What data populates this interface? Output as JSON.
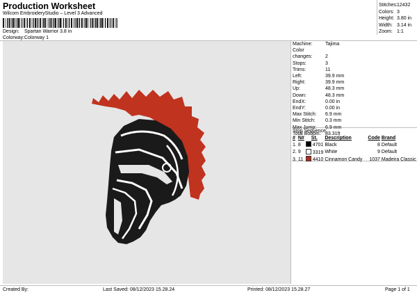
{
  "header": {
    "title": "Production Worksheet",
    "subtitle": "Wilcom EmbroideryStudio – Level 3 Advanced"
  },
  "meta": {
    "design_label": "Design:",
    "design_value": "Spartan Warrior 3.8 in",
    "colorway_label": "Colorway:",
    "colorway_value": "Colorway 1"
  },
  "stats": [
    {
      "label": "Stitches:",
      "value": "12432"
    },
    {
      "label": "Colors:",
      "value": "3"
    },
    {
      "label": "Height:",
      "value": "3.80 in"
    },
    {
      "label": "Width:",
      "value": "3.14 in"
    },
    {
      "label": "Zoom:",
      "value": "1:1"
    }
  ],
  "machine_info": [
    {
      "label": "Machine:",
      "value": "Tajima"
    },
    {
      "label": "Color changes:",
      "value": "2"
    },
    {
      "label": "Stops:",
      "value": "3"
    },
    {
      "label": "Trims:",
      "value": "11"
    },
    {
      "label": "Left:",
      "value": "39.9 mm"
    },
    {
      "label": "Right:",
      "value": "39.9 mm"
    },
    {
      "label": "Up:",
      "value": "48.3 mm"
    },
    {
      "label": "Down:",
      "value": "48.3 mm"
    },
    {
      "label": "EndX:",
      "value": "0.00 in"
    },
    {
      "label": "EndY:",
      "value": "0.00 in"
    },
    {
      "label": "Max Stitch:",
      "value": "6.9 mm"
    },
    {
      "label": "Min Stitch:",
      "value": "0.3 mm"
    },
    {
      "label": "Max Jump:",
      "value": "6.9 mm"
    },
    {
      "label": "Total Bobbin:",
      "value": "83.31ft"
    }
  ],
  "stop_sequence": {
    "title": "Stop Sequence:",
    "columns": [
      "#",
      "N#",
      "St.",
      "Description",
      "Code",
      "Brand"
    ],
    "rows": [
      {
        "num": "1.",
        "n": "8",
        "color": "#000000",
        "st": "4701",
        "desc": "Black",
        "code": "8",
        "brand": "Default"
      },
      {
        "num": "2.",
        "n": "9",
        "color": "#ffffff",
        "st": "3319",
        "desc": "White",
        "code": "9",
        "brand": "Default"
      },
      {
        "num": "3.",
        "n": "11",
        "color": "#b22a1a",
        "st": "4410",
        "desc": "Cinnamon Candy",
        "code": "1037",
        "brand": "Madeira Classic 40"
      }
    ]
  },
  "footer": {
    "created_by": "Created By:",
    "last_saved": "Last Saved: 08/12/2023 15.28.24",
    "printed": "Printed: 08/12/2023 15.28.27",
    "page": "Page 1 of 1"
  },
  "colors": {
    "background": "#e6e6e6",
    "plume": "#c0331f",
    "helmet": "#1a1a1a",
    "highlight": "#ffffff"
  }
}
